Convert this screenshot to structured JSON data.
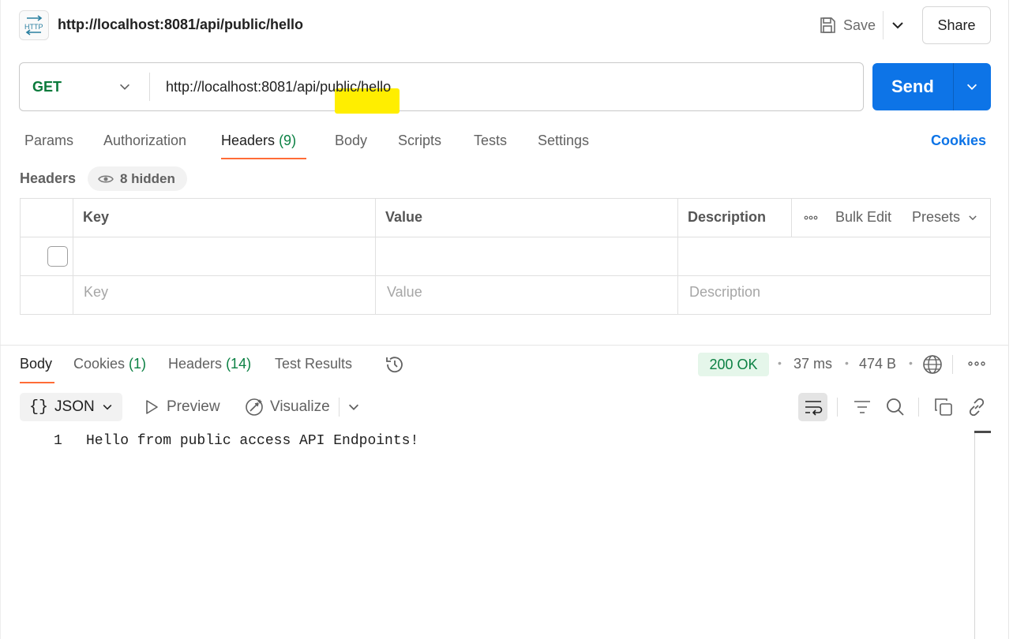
{
  "request": {
    "badge": "HTTP",
    "title": "http://localhost:8081/api/public/hello",
    "save_label": "Save",
    "share_label": "Share",
    "method": "GET",
    "url": "http://localhost:8081/api/public/hello",
    "send_label": "Send"
  },
  "request_tabs": {
    "params": "Params",
    "authorization": "Authorization",
    "headers": "Headers",
    "headers_count": "(9)",
    "body": "Body",
    "scripts": "Scripts",
    "tests": "Tests",
    "settings": "Settings",
    "cookies": "Cookies"
  },
  "headers_section": {
    "label": "Headers",
    "hidden_label": "8 hidden",
    "columns": {
      "key": "Key",
      "value": "Value",
      "description": "Description"
    },
    "bulk_edit": "Bulk Edit",
    "presets": "Presets",
    "placeholders": {
      "key": "Key",
      "value": "Value",
      "description": "Description"
    }
  },
  "response": {
    "tabs": {
      "body": "Body",
      "cookies": "Cookies",
      "cookies_count": "(1)",
      "headers": "Headers",
      "headers_count": "(14)",
      "test_results": "Test Results"
    },
    "status": "200 OK",
    "time": "37 ms",
    "size": "474 B",
    "format": "JSON",
    "preview": "Preview",
    "visualize": "Visualize",
    "lines": [
      {
        "no": "1",
        "text": "Hello from public access API Endpoints!"
      }
    ]
  },
  "colors": {
    "accent": "#0d74e7",
    "tab_underline": "#ff6c37",
    "method_get": "#0b7a3b",
    "status_ok_bg": "#e5f6ea",
    "highlight": "#ffee00"
  }
}
